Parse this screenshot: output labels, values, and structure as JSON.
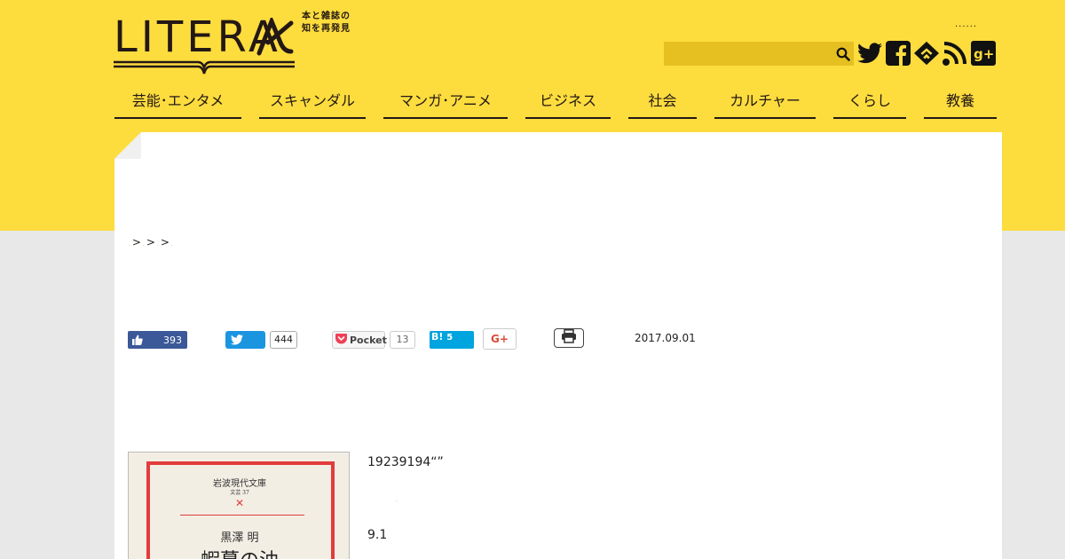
{
  "brand": {
    "logo": "LITERA",
    "tagline_line1": "本と雑誌の",
    "tagline_line2": "知を再発見"
  },
  "header": {
    "dots": "......",
    "search_placeholder": "",
    "social_icons": [
      "twitter-icon",
      "facebook-icon",
      "feedly-icon",
      "rss-icon",
      "googleplus-icon"
    ]
  },
  "nav": {
    "items": [
      {
        "label": "芸能･エンタメ"
      },
      {
        "label": "スキャンダル"
      },
      {
        "label": "マンガ･アニメ"
      },
      {
        "label": "ビジネス"
      },
      {
        "label": "社会"
      },
      {
        "label": "カルチャー"
      },
      {
        "label": "くらし"
      },
      {
        "label": "教養"
      }
    ]
  },
  "breadcrumb": {
    "sep": ">",
    "crumbs": [
      ".",
      ".",
      ".",
      "."
    ]
  },
  "share": {
    "facebook_count": "393",
    "twitter_count": "444",
    "pocket_label": "Pocket",
    "pocket_count": "13",
    "hatena_label": "B!",
    "hatena_count": "5",
    "gplus_label": "G+",
    "date": "2017.09.01"
  },
  "book": {
    "series": "岩波現代文庫",
    "number": "文芸 37",
    "author": "黒澤 明",
    "title": "蝦蟇の油"
  },
  "article": {
    "line1": "19239194“”",
    "line2": ".",
    "line3": "9.1"
  },
  "colors": {
    "band": "#fddc3e",
    "search": "#e6c021",
    "facebook": "#3b5998",
    "twitter": "#1b95e0",
    "hatena": "#00a4de"
  }
}
